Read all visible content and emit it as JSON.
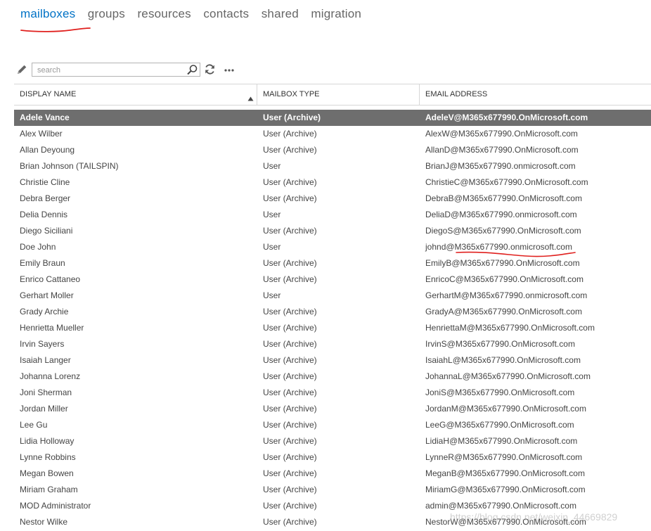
{
  "tabs": [
    {
      "label": "mailboxes",
      "active": true
    },
    {
      "label": "groups"
    },
    {
      "label": "resources"
    },
    {
      "label": "contacts"
    },
    {
      "label": "shared"
    },
    {
      "label": "migration"
    }
  ],
  "toolbar": {
    "edit_icon": "pencil-icon",
    "search_placeholder": "search",
    "search_icon": "search-icon",
    "refresh_icon": "refresh-icon",
    "more_icon": "more-icon"
  },
  "grid": {
    "columns": [
      "DISPLAY NAME",
      "MAILBOX TYPE",
      "EMAIL ADDRESS"
    ],
    "sort": {
      "column": "DISPLAY NAME",
      "direction": "ascending"
    },
    "rows": [
      {
        "name": "Adele Vance",
        "type": "User (Archive)",
        "email": "AdeleV@M365x677990.OnMicrosoft.com",
        "selected": true
      },
      {
        "name": "Alex Wilber",
        "type": "User (Archive)",
        "email": "AlexW@M365x677990.OnMicrosoft.com"
      },
      {
        "name": "Allan Deyoung",
        "type": "User (Archive)",
        "email": "AllanD@M365x677990.OnMicrosoft.com"
      },
      {
        "name": "Brian Johnson (TAILSPIN)",
        "type": "User",
        "email": "BrianJ@M365x677990.onmicrosoft.com"
      },
      {
        "name": "Christie Cline",
        "type": "User (Archive)",
        "email": "ChristieC@M365x677990.OnMicrosoft.com"
      },
      {
        "name": "Debra Berger",
        "type": "User (Archive)",
        "email": "DebraB@M365x677990.OnMicrosoft.com"
      },
      {
        "name": "Delia Dennis",
        "type": "User",
        "email": "DeliaD@M365x677990.onmicrosoft.com"
      },
      {
        "name": "Diego Siciliani",
        "type": "User (Archive)",
        "email": "DiegoS@M365x677990.OnMicrosoft.com"
      },
      {
        "name": "Doe John",
        "type": "User",
        "email": "johnd@M365x677990.onmicrosoft.com"
      },
      {
        "name": "Emily Braun",
        "type": "User (Archive)",
        "email": "EmilyB@M365x677990.OnMicrosoft.com"
      },
      {
        "name": "Enrico Cattaneo",
        "type": "User (Archive)",
        "email": "EnricoC@M365x677990.OnMicrosoft.com"
      },
      {
        "name": "Gerhart Moller",
        "type": "User",
        "email": "GerhartM@M365x677990.onmicrosoft.com"
      },
      {
        "name": "Grady Archie",
        "type": "User (Archive)",
        "email": "GradyA@M365x677990.OnMicrosoft.com"
      },
      {
        "name": "Henrietta Mueller",
        "type": "User (Archive)",
        "email": "HenriettaM@M365x677990.OnMicrosoft.com"
      },
      {
        "name": "Irvin Sayers",
        "type": "User (Archive)",
        "email": "IrvinS@M365x677990.OnMicrosoft.com"
      },
      {
        "name": "Isaiah Langer",
        "type": "User (Archive)",
        "email": "IsaiahL@M365x677990.OnMicrosoft.com"
      },
      {
        "name": "Johanna Lorenz",
        "type": "User (Archive)",
        "email": "JohannaL@M365x677990.OnMicrosoft.com"
      },
      {
        "name": "Joni Sherman",
        "type": "User (Archive)",
        "email": "JoniS@M365x677990.OnMicrosoft.com"
      },
      {
        "name": "Jordan Miller",
        "type": "User (Archive)",
        "email": "JordanM@M365x677990.OnMicrosoft.com"
      },
      {
        "name": "Lee Gu",
        "type": "User (Archive)",
        "email": "LeeG@M365x677990.OnMicrosoft.com"
      },
      {
        "name": "Lidia Holloway",
        "type": "User (Archive)",
        "email": "LidiaH@M365x677990.OnMicrosoft.com"
      },
      {
        "name": "Lynne Robbins",
        "type": "User (Archive)",
        "email": "LynneR@M365x677990.OnMicrosoft.com"
      },
      {
        "name": "Megan Bowen",
        "type": "User (Archive)",
        "email": "MeganB@M365x677990.OnMicrosoft.com"
      },
      {
        "name": "Miriam Graham",
        "type": "User (Archive)",
        "email": "MiriamG@M365x677990.OnMicrosoft.com"
      },
      {
        "name": "MOD Administrator",
        "type": "User (Archive)",
        "email": "admin@M365x677990.OnMicrosoft.com"
      },
      {
        "name": "Nestor Wilke",
        "type": "User (Archive)",
        "email": "NestorW@M365x677990.OnMicrosoft.com"
      }
    ]
  },
  "watermark": "https://blog.csdn.net/weixin_44669829",
  "colors": {
    "accent": "#0072c6",
    "tab_inactive": "#666666",
    "selected_row": "#6e6e6e",
    "annotation": "#e0201e"
  }
}
